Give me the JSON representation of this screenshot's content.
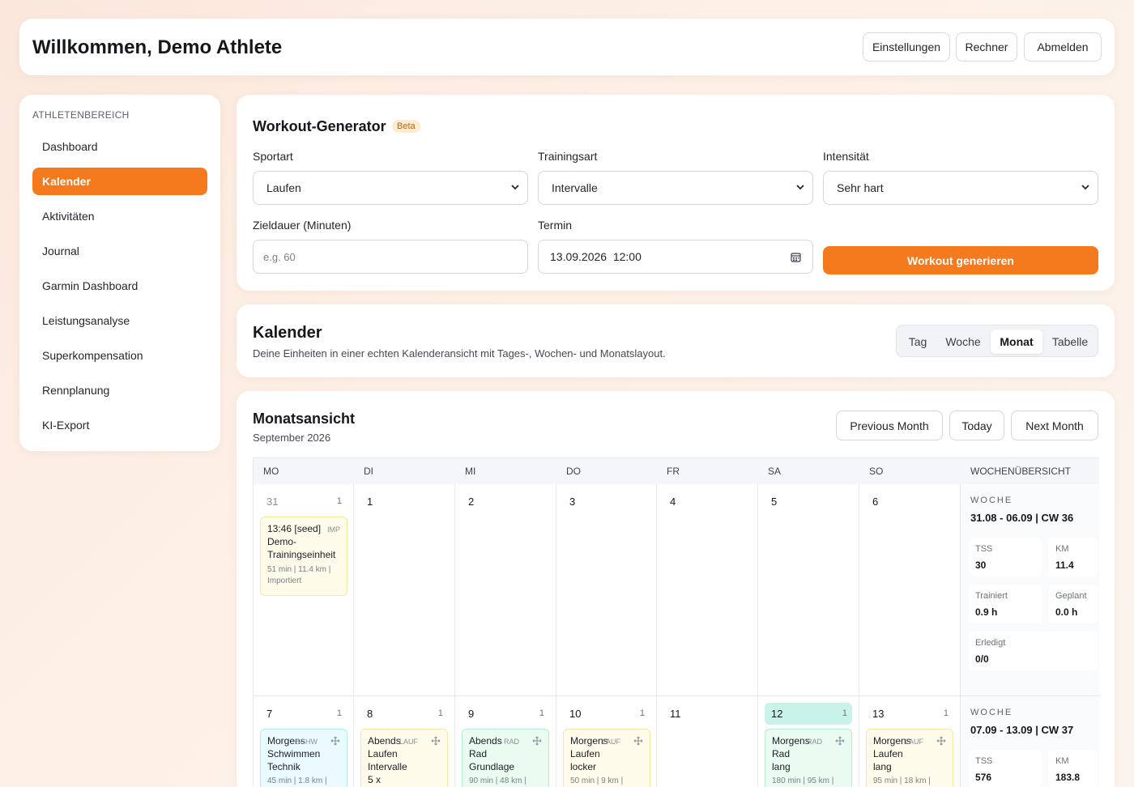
{
  "header": {
    "title": "Willkommen, Demo Athlete",
    "buttons": [
      "Einstellungen",
      "Rechner",
      "Abmelden"
    ]
  },
  "sidebar": {
    "section": "ATHLETENBEREICH",
    "items": [
      "Dashboard",
      "Kalender",
      "Aktivitäten",
      "Journal",
      "Garmin Dashboard",
      "Leistungsanalyse",
      "Superkompensation",
      "Rennplanung",
      "KI-Export"
    ],
    "active": "Kalender"
  },
  "generator": {
    "title": "Workout-Generator",
    "badge": "Beta",
    "sportart_label": "Sportart",
    "sportart_value": "Laufen",
    "trainingsart_label": "Trainingsart",
    "trainingsart_value": "Intervalle",
    "intensitaet_label": "Intensität",
    "intensitaet_value": "Sehr hart",
    "dauer_label": "Zieldauer (Minuten)",
    "dauer_placeholder": "e.g. 60",
    "termin_label": "Termin",
    "termin_value": "13.09.2026  12:00",
    "generate_label": "Workout generieren"
  },
  "calendar": {
    "title": "Kalender",
    "subtitle": "Deine Einheiten in einer echten Kalenderansicht mit Tages-, Wochen- und Monatslayout.",
    "views": [
      "Tag",
      "Woche",
      "Monat",
      "Tabelle"
    ],
    "active_view": "Monat"
  },
  "month": {
    "title": "Monatsansicht",
    "subtitle": "September 2026",
    "prev_label": "Previous Month",
    "today_label": "Today",
    "next_label": "Next Month",
    "day_headers": [
      "MO",
      "DI",
      "MI",
      "DO",
      "FR",
      "SA",
      "SO"
    ],
    "summary_header": "WOCHENÜBERSICHT",
    "week1": {
      "days": [
        {
          "num": "31",
          "count": "1",
          "muted": true
        },
        {
          "num": "1",
          "count": ""
        },
        {
          "num": "2",
          "count": ""
        },
        {
          "num": "3",
          "count": ""
        },
        {
          "num": "4",
          "count": ""
        },
        {
          "num": "5",
          "count": ""
        },
        {
          "num": "6",
          "count": ""
        }
      ],
      "event": {
        "line1": "13:46 [seed]",
        "tag": "IMP",
        "line2": "Demo-Trainingseinheit",
        "meta": "51 min | 11.4 km | Importiert"
      },
      "summary": {
        "label": "WOCHE",
        "range": "31.08 - 06.09 | CW 36",
        "stats": [
          {
            "label": "TSS",
            "value": "30"
          },
          {
            "label": "KM",
            "value": "11.4"
          },
          {
            "label": "Trainiert",
            "value": "0.9 h"
          },
          {
            "label": "Geplant",
            "value": "0.0 h"
          },
          {
            "label": "Erledigt",
            "value": "0/0"
          }
        ]
      }
    },
    "week2": {
      "days": [
        {
          "num": "7",
          "count": "1"
        },
        {
          "num": "8",
          "count": "1"
        },
        {
          "num": "9",
          "count": "1"
        },
        {
          "num": "10",
          "count": "1"
        },
        {
          "num": "11",
          "count": ""
        },
        {
          "num": "12",
          "count": "1"
        },
        {
          "num": "13",
          "count": "1"
        }
      ],
      "events": [
        {
          "title": "Morgens",
          "tag": "SCHW",
          "l2": "Schwimmen",
          "l3": "Technik",
          "meta": "45 min | 1.8 km |"
        },
        {
          "title": "Abends",
          "tag": "LAUF",
          "l2": "Laufen",
          "l3": "Intervalle",
          "l4": "5 x"
        },
        {
          "title": "Abends",
          "tag": "RAD",
          "l2": "Rad",
          "l3": "Grundlage",
          "meta": "90 min | 48 km |"
        },
        {
          "title": "Morgens",
          "tag": "LAUF",
          "l2": "Laufen",
          "l3": "locker",
          "meta": "50 min | 9 km |"
        },
        {
          "title": "Morgens",
          "tag": "RAD",
          "l2": "Rad",
          "l3": "lang",
          "meta": "180 min | 95 km |"
        },
        {
          "title": "Morgens",
          "tag": "LAUF",
          "l2": "Laufen",
          "l3": "lang",
          "meta": "95 min | 18 km |"
        }
      ],
      "summary": {
        "label": "WOCHE",
        "range": "07.09 - 13.09 | CW 37",
        "stats": [
          {
            "label": "TSS",
            "value": "576"
          },
          {
            "label": "KM",
            "value": "183.8"
          }
        ]
      }
    }
  },
  "colors": {
    "accent": "#f47a1d",
    "today": "#c9f3e9"
  }
}
